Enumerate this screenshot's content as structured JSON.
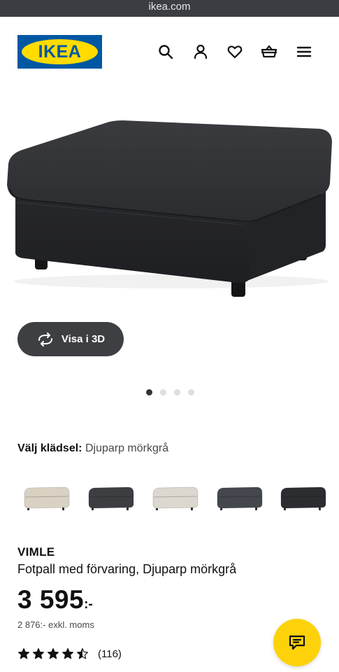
{
  "browser": {
    "url": "ikea.com"
  },
  "header": {
    "logo_text": "IKEA",
    "icons": [
      "search-icon",
      "user-icon",
      "heart-icon",
      "basket-icon",
      "menu-icon"
    ]
  },
  "hero": {
    "view_3d_label": "Visa i 3D",
    "carousel": {
      "count": 4,
      "active": 1
    }
  },
  "fabric": {
    "label": "Välj klädsel:",
    "value": "Djuparp mörkgrå",
    "swatches": [
      {
        "color": "#d9d2c3"
      },
      {
        "color": "#3d3e42"
      },
      {
        "color": "#dcd8cf"
      },
      {
        "color": "#44474d"
      },
      {
        "color": "#2c2d31"
      }
    ]
  },
  "product": {
    "brand": "VIMLE",
    "description": "Fotpall med förvaring, Djuparp mörkgrå",
    "price_main": "3 595",
    "price_suffix": ":-",
    "price_excl_vat": "2 876:- exkl. moms",
    "rating": 4.5,
    "reviews": "(116)"
  },
  "colors": {
    "ikea_blue": "#0058a3",
    "ikea_yellow": "#ffdb00",
    "chat_yellow": "#fdd20a"
  }
}
